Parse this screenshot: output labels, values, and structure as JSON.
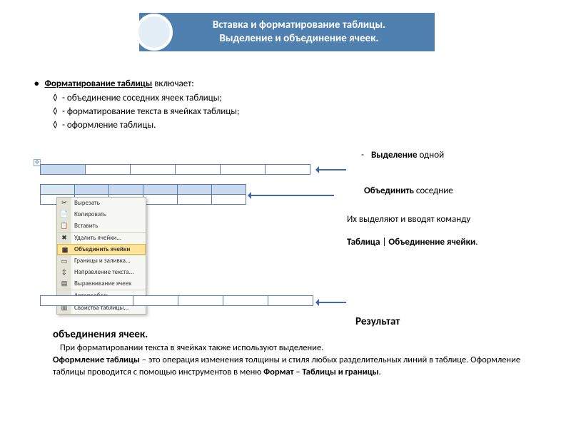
{
  "header": {
    "line1": "Вставка и форматирование таблицы.",
    "line2": "Выделение и объединение ячеек."
  },
  "heading": {
    "bold": "Форматирование таблицы",
    "rest": " включает:"
  },
  "subs": {
    "a": "- объединение соседних ячеек таблицы;",
    "b": "- форматирование текста в ячейках таблицы;",
    "c": "- оформление таблицы."
  },
  "captions": {
    "sel_word": "Выделение ",
    "sel_tail": "одной",
    "merge_word": "Объединить ",
    "merge_tail": "соседние",
    "line3": "Их выделяют и вводят команду",
    "line4a": "Таблица",
    "line4sep": " | ",
    "line4b": "Объединение ячейки"
  },
  "context_menu": {
    "items": [
      {
        "icon": "✂",
        "label": "Вырезать"
      },
      {
        "icon": "📄",
        "label": "Копировать"
      },
      {
        "icon": "📋",
        "label": "Вставить"
      },
      {
        "icon": "✖",
        "label": "Удалить ячейки...",
        "sep": true
      },
      {
        "icon": "▦",
        "label": "Объединить ячейки",
        "hi": true
      },
      {
        "icon": "▭",
        "label": "Границы и заливка...",
        "sep": true
      },
      {
        "icon": "↕",
        "label": "Направление текста..."
      },
      {
        "icon": "▤",
        "label": "Выравнивание ячеек"
      },
      {
        "icon": "",
        "label": "Автоподбор",
        "sep": true
      },
      {
        "icon": "▥",
        "label": "Свойства таблицы...",
        "sep": true
      }
    ]
  },
  "result": {
    "word": "Результат",
    "cont": "объединения ячеек."
  },
  "paragraph": {
    "p1": "При форматировании текста в ячейках также используют выделение.",
    "p2a": "Оформление таблицы",
    "p2b": " – это операция изменения толщины и стиля любых разделительных линий в таблице. Оформление таблицы проводится с помощью инструментов  в меню ",
    "p2c": "Формат – Таблицы и границы",
    "p2d": "."
  }
}
